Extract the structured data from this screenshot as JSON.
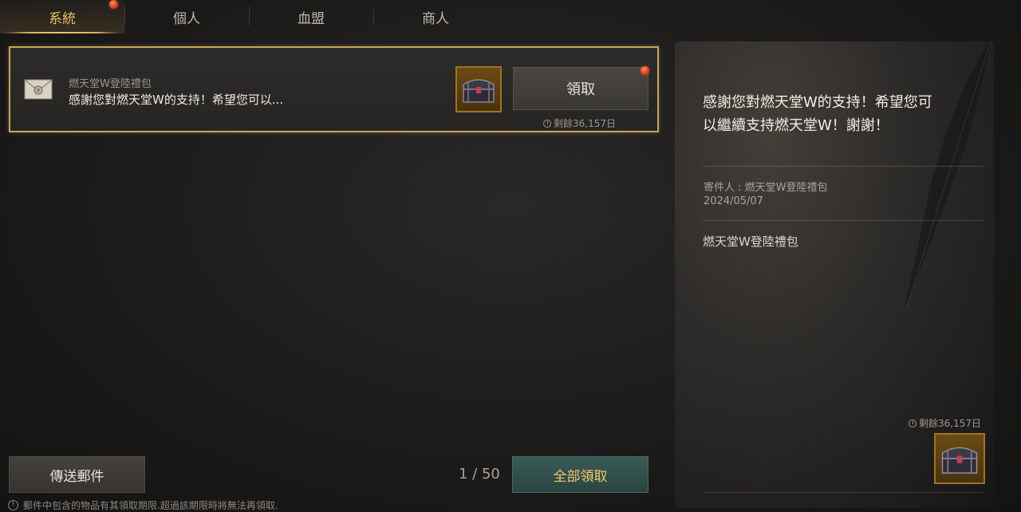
{
  "tabs": [
    {
      "label": "系統",
      "active": true,
      "has_alert": true
    },
    {
      "label": "個人",
      "active": false
    },
    {
      "label": "血盟",
      "active": false
    },
    {
      "label": "商人",
      "active": false
    }
  ],
  "mail": {
    "sender": "燃天堂W登陸禮包",
    "preview": "感謝您對燃天堂W的支持！希望您可以...",
    "claim_label": "領取",
    "remaining": "剩餘36,157日",
    "item_icon": "treasure-chest-icon"
  },
  "detail": {
    "message": "感謝您對燃天堂W的支持！希望您可以繼續支持燃天堂W！謝謝！",
    "sender_line": "寄件人 : 燃天堂W登陸禮包",
    "date": "2024/05/07",
    "attachment_title": "燃天堂W登陸禮包",
    "remaining": "剩餘36,157日"
  },
  "footer": {
    "send_label": "傳送郵件",
    "pager": "1 / 50",
    "claim_all_label": "全部領取",
    "notice": "郵件中包含的物品有其領取期限.超過該期限時將無法再領取."
  },
  "colors": {
    "accent_gold": "#e7c272",
    "border_gold": "#c9a55c",
    "alert_red": "#c9361c",
    "teal_button": "#3a5a55"
  }
}
